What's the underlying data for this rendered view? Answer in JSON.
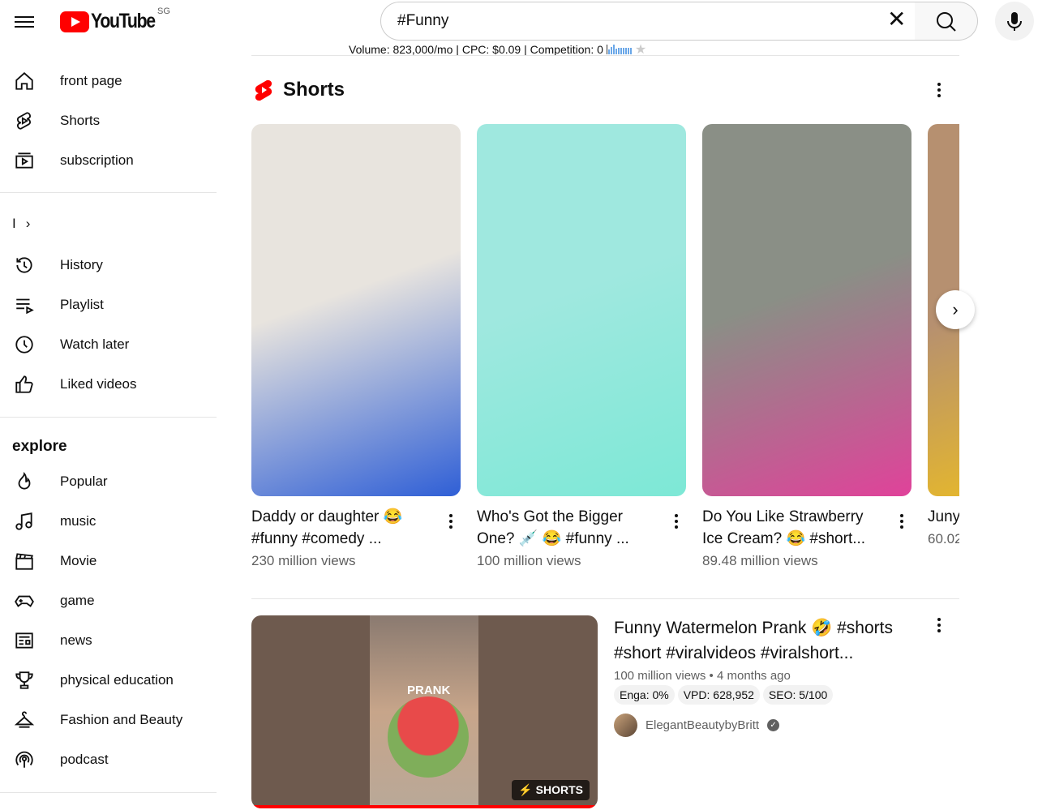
{
  "header": {
    "logo": "YouTube",
    "region": "SG",
    "search_value": "#Funny",
    "keyword_stats": "Volume: 823,000/mo | CPC: $0.09 | Competition: 0"
  },
  "sidebar": {
    "main": [
      {
        "label": "front page",
        "icon": "home-icon"
      },
      {
        "label": "Shorts",
        "icon": "shorts-icon"
      },
      {
        "label": "subscription",
        "icon": "subscriptions-icon"
      }
    ],
    "you_label": "I",
    "you": [
      {
        "label": "History",
        "icon": "history-icon"
      },
      {
        "label": "Playlist",
        "icon": "playlist-icon"
      },
      {
        "label": "Watch later",
        "icon": "clock-icon"
      },
      {
        "label": "Liked videos",
        "icon": "thumbs-up-icon"
      }
    ],
    "explore_title": "explore",
    "explore": [
      {
        "label": "Popular",
        "icon": "fire-icon"
      },
      {
        "label": "music",
        "icon": "music-icon"
      },
      {
        "label": "Movie",
        "icon": "clapperboard-icon"
      },
      {
        "label": "game",
        "icon": "gamepad-icon"
      },
      {
        "label": "news",
        "icon": "newspaper-icon"
      },
      {
        "label": "physical education",
        "icon": "trophy-icon"
      },
      {
        "label": "Fashion and Beauty",
        "icon": "hanger-icon"
      },
      {
        "label": "podcast",
        "icon": "podcast-icon"
      }
    ]
  },
  "shorts": {
    "title": "Shorts",
    "accent": "#ff0000",
    "items": [
      {
        "title": "Daddy or daughter 😂 #funny #comedy ...",
        "views": "230 million views",
        "colors": [
          "#e8e4de",
          "#2f5fd6"
        ]
      },
      {
        "title": "Who's Got the Bigger One? 💉 😂 #funny ...",
        "views": "100 million views",
        "colors": [
          "#9fe8df",
          "#7de8d6"
        ]
      },
      {
        "title": "Do You Like Strawberry Ice Cream? 😂 #short...",
        "views": "89.48 million views",
        "colors": [
          "#8a8f86",
          "#e0429a"
        ]
      },
      {
        "title": "Juny 😂😂",
        "views": "60.02",
        "colors": [
          "#b69070",
          "#f2c21a"
        ]
      }
    ]
  },
  "video": {
    "title": "Funny Watermelon Prank 🤣 #shorts #short #viralvideos #viralshort...",
    "meta": "100 million views • 4 months ago",
    "chips": [
      "Enga: 0%",
      "VPD: 628,952",
      "SEO: 5/100"
    ],
    "channel": "ElegantBeautybyBritt",
    "badge": "SHORTS",
    "thumb_text": "PRANK"
  }
}
